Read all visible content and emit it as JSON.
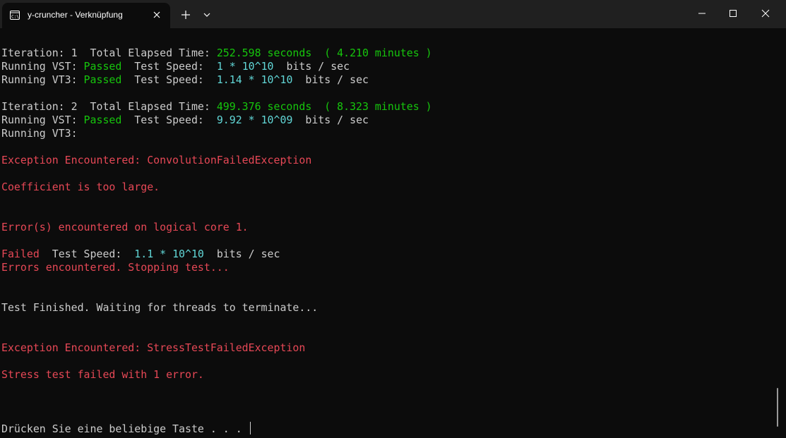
{
  "window": {
    "tab_title": "y-cruncher - Verknüpfung",
    "icons": {
      "tab": "terminal-icon",
      "close_tab": "close-icon",
      "new_tab": "plus-icon",
      "dropdown": "chevron-down-icon",
      "minimize": "minimize-icon",
      "maximize": "maximize-icon",
      "close": "close-icon"
    }
  },
  "colors": {
    "background": "#0c0c0c",
    "text": "#cccccc",
    "passed": "#16c60c",
    "speed": "#61d6d6",
    "error": "#e74856"
  },
  "terminal": {
    "it1": {
      "label": "Iteration: 1  Total Elapsed Time: ",
      "time": "252.598 seconds  ( 4.210 minutes )",
      "vst_label": "Running VST: ",
      "vst_status": "Passed",
      "vst_speed_label": "  Test Speed:  ",
      "vst_speed": "1 * 10^10",
      "vst_unit": "  bits / sec",
      "vt3_label": "Running VT3: ",
      "vt3_status": "Passed",
      "vt3_speed_label": "  Test Speed:  ",
      "vt3_speed": "1.14 * 10^10",
      "vt3_unit": "  bits / sec"
    },
    "it2": {
      "label": "Iteration: 2  Total Elapsed Time: ",
      "time": "499.376 seconds  ( 8.323 minutes )",
      "vst_label": "Running VST: ",
      "vst_status": "Passed",
      "vst_speed_label": "  Test Speed:  ",
      "vst_speed": "9.92 * 10^09",
      "vst_unit": "  bits / sec",
      "vt3_label": "Running VT3:"
    },
    "exception1": "Exception Encountered: ConvolutionFailedException",
    "coefficient": "Coefficient is too large.",
    "core_error": "Error(s) encountered on logical core 1.",
    "failed_status": "Failed",
    "failed_speed_label": "  Test Speed:  ",
    "failed_speed": "1.1 * 10^10",
    "failed_unit": "  bits / sec",
    "errors_stopping": "Errors encountered. Stopping test...",
    "test_finished": "Test Finished. Waiting for threads to terminate...",
    "exception2": "Exception Encountered: StressTestFailedException",
    "stress_failed": "Stress test failed with 1 error.",
    "prompt": "Drücken Sie eine beliebige Taste . . . "
  }
}
